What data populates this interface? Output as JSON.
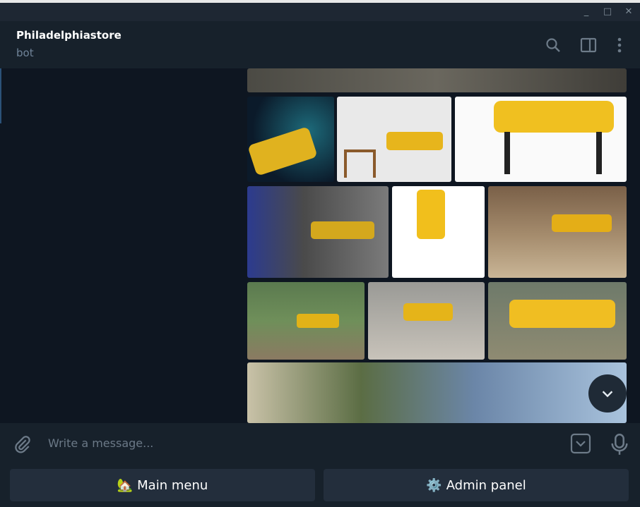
{
  "window": {
    "minimize": "_",
    "maximize": "□",
    "close": "✕"
  },
  "header": {
    "title": "Philadelphiastore",
    "subtitle": "bot"
  },
  "input": {
    "placeholder": "Write a message..."
  },
  "keyboard": [
    {
      "icon": "🏡",
      "label": "Main menu"
    },
    {
      "icon": "⚙️",
      "label": "Admin panel"
    }
  ]
}
